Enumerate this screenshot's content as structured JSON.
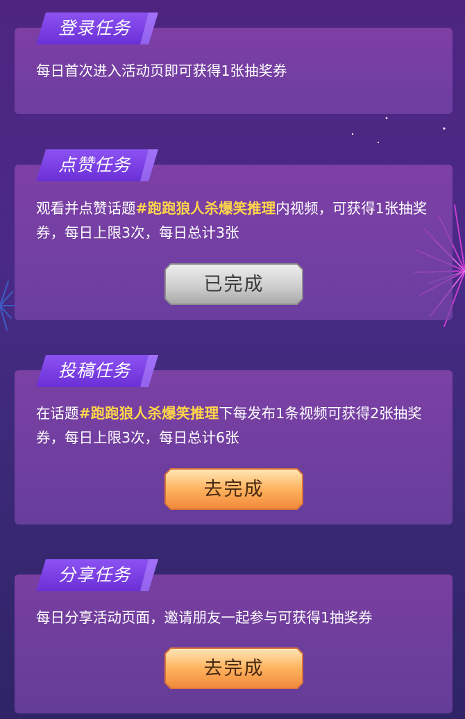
{
  "tasks": [
    {
      "title": "登录任务",
      "desc_pre": "每日首次进入活动页即可获得1张抽奖券",
      "desc_hl": "",
      "desc_post": ""
    },
    {
      "title": "点赞任务",
      "desc_pre": "观看并点赞话题",
      "desc_hl": "#跑跑狼人杀爆笑推理",
      "desc_post": "内视频，可获得1张抽奖券，每日上限3次，每日总计3张",
      "button_label": "已完成",
      "button_state": "completed"
    },
    {
      "title": "投稿任务",
      "desc_pre": "在话题",
      "desc_hl": "#跑跑狼人杀爆笑推理",
      "desc_post": "下每发布1条视频可获得2张抽奖券，每日上限3次，每日总计6张",
      "button_label": "去完成",
      "button_state": "todo"
    },
    {
      "title": "分享任务",
      "desc_pre": "每日分享活动页面，邀请朋友一起参与可获得1抽奖券",
      "desc_hl": "",
      "desc_post": "",
      "button_label": "去完成",
      "button_state": "todo"
    }
  ],
  "colors": {
    "highlight": "#ffd64a",
    "tag": "#7b3fe0",
    "button_todo": "#ffb25a",
    "button_done": "#c9c9c9"
  }
}
